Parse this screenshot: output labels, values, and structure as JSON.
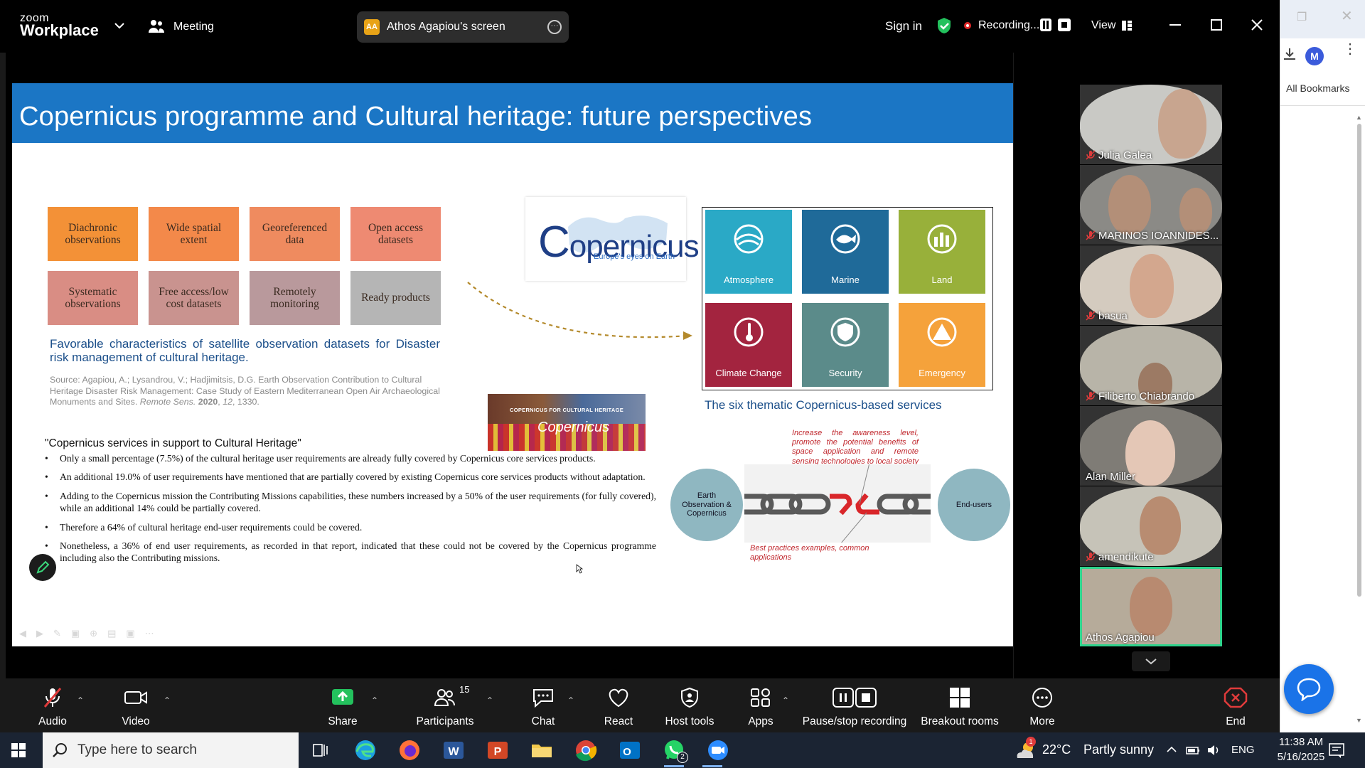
{
  "zoom": {
    "logo_small": "zoom",
    "logo_big": "Workplace",
    "meeting_label": "Meeting",
    "screen_pill": {
      "initials": "AA",
      "label": "Athos Agapiou's screen"
    },
    "sign_in": "Sign in",
    "recording_label": "Recording...",
    "view_label": "View"
  },
  "browser": {
    "avatar_initial": "M",
    "bookmarks_label": "All Bookmarks"
  },
  "slide": {
    "title": "Copernicus programme and Cultural heritage: future perspectives",
    "tiles": [
      {
        "label": "Diachronic observations",
        "color": "#f39137"
      },
      {
        "label": "Wide spatial extent",
        "color": "#f3894a"
      },
      {
        "label": "Georeferenced data",
        "color": "#ef8b5f"
      },
      {
        "label": "Open access datasets",
        "color": "#ee8a72"
      },
      {
        "label": "Systematic observations",
        "color": "#d98d84"
      },
      {
        "label": "Free access/low cost datasets",
        "color": "#c9938f"
      },
      {
        "label": "Remotely monitoring",
        "color": "#b9999c"
      },
      {
        "label": "Ready products",
        "color": "#b5b5b5"
      }
    ],
    "caption_left": "Favorable characteristics of satellite observation datasets for Disaster risk management of cultural heritage.",
    "source_pre": "Source: Agapiou, A.; Lysandrou, V.; Hadjimitsis, D.G. Earth Observation Contribution to Cultural Heritage Disaster Risk Management: Case Study of Eastern Mediterranean Open Air Archaeological Monuments and Sites.",
    "source_journal": "Remote Sens.",
    "source_year": "2020",
    "source_vol": "12",
    "source_pages": ", 1330.",
    "copernicus_logo": {
      "name": "opernicus",
      "initial": "C",
      "tagline": "Europe's eyes on Earth"
    },
    "services": [
      {
        "label": "Atmosphere",
        "color": "#2aa9c6",
        "icon": "atmosphere-icon"
      },
      {
        "label": "Marine",
        "color": "#1f6a99",
        "icon": "marine-icon"
      },
      {
        "label": "Land",
        "color": "#98b03a",
        "icon": "land-icon"
      },
      {
        "label": "Climate Change",
        "color": "#a3243f",
        "icon": "climate-icon"
      },
      {
        "label": "Security",
        "color": "#5b8b8a",
        "icon": "security-icon"
      },
      {
        "label": "Emergency",
        "color": "#f5a23b",
        "icon": "emergency-icon"
      }
    ],
    "caption_right": "The six thematic Copernicus-based services",
    "banner_text": "COPERNICUS FOR CULTURAL HERITAGE",
    "banner_logo": "Copernicus",
    "bullets_heading": "\"Copernicus services in support to Cultural Heritage\"",
    "bullets": [
      "Only a small percentage (7.5%) of the cultural heritage user requirements are already fully covered by Copernicus core services products.",
      "An additional 19.0% of user requirements have mentioned that are partially covered by existing Copernicus core services products without adaptation.",
      "Adding to the Copernicus mission the Contributing Missions capabilities, these numbers increased by a 50% of the user requirements (for fully covered), while an additional 14% could be partially covered.",
      "Therefore a 64% of cultural heritage end-user requirements could be covered.",
      "Nonetheless, a 36% of end user requirements, as recorded in that report, indicated that these could not be covered by the Copernicus programme including also the Contributing missions."
    ],
    "diagram": {
      "left_circle": "Earth Observation & Copernicus",
      "right_circle": "End-users",
      "top_note": "Increase the awareness level, promote the potential benefits of space application and remote sensing technologies to local society",
      "bottom_note": "Best practices examples, common applications"
    }
  },
  "participants": [
    {
      "name": "Julia Galea",
      "muted": true,
      "bg": "#c9c9c5",
      "skin": "#c8a58f"
    },
    {
      "name": "MARINOS IOANNIDES...",
      "muted": true,
      "bg": "#8b8a86",
      "skin": "#b38f78"
    },
    {
      "name": "basua",
      "muted": true,
      "bg": "#d4cbbf",
      "skin": "#d3a78e"
    },
    {
      "name": "Filiberto Chiabrando",
      "muted": true,
      "bg": "#b8b4a8",
      "skin": "#9c7a64"
    },
    {
      "name": "Alan Miller",
      "muted": false,
      "bg": "#7f7c76",
      "skin": "#e4c7b6"
    },
    {
      "name": "amendikute",
      "muted": true,
      "bg": "#c6c3b8",
      "skin": "#b88c71"
    },
    {
      "name": "Athos Agapiou",
      "muted": false,
      "bg": "#b6ab9a",
      "skin": "#b88a70"
    }
  ],
  "toolbar": {
    "audio": "Audio",
    "video": "Video",
    "share": "Share",
    "participants": "Participants",
    "participants_count": "15",
    "chat": "Chat",
    "react": "React",
    "host_tools": "Host tools",
    "apps": "Apps",
    "pause_stop": "Pause/stop recording",
    "breakout": "Breakout rooms",
    "more": "More",
    "end": "End"
  },
  "taskbar": {
    "search_placeholder": "Type here to search",
    "whatsapp_badge": "2",
    "weather_badge": "1",
    "temperature": "22°C",
    "weather": "Partly sunny",
    "language": "ENG",
    "time": "11:38 AM",
    "date": "5/16/2025"
  }
}
